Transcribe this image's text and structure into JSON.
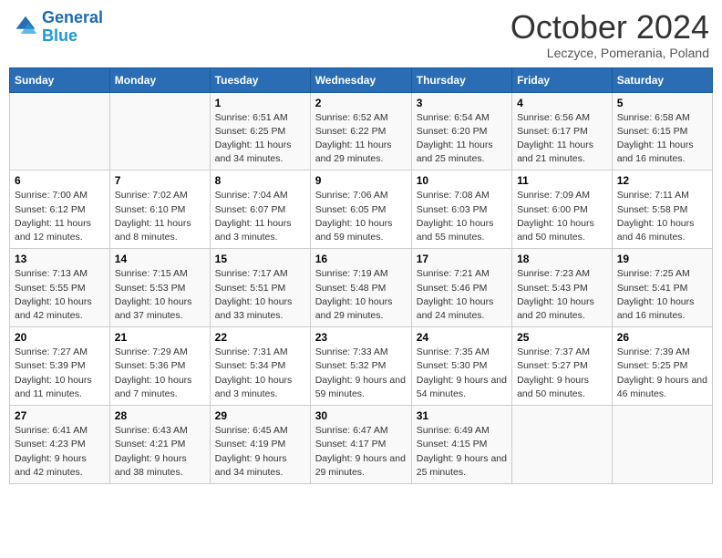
{
  "header": {
    "logo_line1": "General",
    "logo_line2": "Blue",
    "month": "October 2024",
    "location": "Leczyce, Pomerania, Poland"
  },
  "days_of_week": [
    "Sunday",
    "Monday",
    "Tuesday",
    "Wednesday",
    "Thursday",
    "Friday",
    "Saturday"
  ],
  "weeks": [
    [
      {
        "day": "",
        "sunrise": "",
        "sunset": "",
        "daylight": ""
      },
      {
        "day": "",
        "sunrise": "",
        "sunset": "",
        "daylight": ""
      },
      {
        "day": "1",
        "sunrise": "Sunrise: 6:51 AM",
        "sunset": "Sunset: 6:25 PM",
        "daylight": "Daylight: 11 hours and 34 minutes."
      },
      {
        "day": "2",
        "sunrise": "Sunrise: 6:52 AM",
        "sunset": "Sunset: 6:22 PM",
        "daylight": "Daylight: 11 hours and 29 minutes."
      },
      {
        "day": "3",
        "sunrise": "Sunrise: 6:54 AM",
        "sunset": "Sunset: 6:20 PM",
        "daylight": "Daylight: 11 hours and 25 minutes."
      },
      {
        "day": "4",
        "sunrise": "Sunrise: 6:56 AM",
        "sunset": "Sunset: 6:17 PM",
        "daylight": "Daylight: 11 hours and 21 minutes."
      },
      {
        "day": "5",
        "sunrise": "Sunrise: 6:58 AM",
        "sunset": "Sunset: 6:15 PM",
        "daylight": "Daylight: 11 hours and 16 minutes."
      }
    ],
    [
      {
        "day": "6",
        "sunrise": "Sunrise: 7:00 AM",
        "sunset": "Sunset: 6:12 PM",
        "daylight": "Daylight: 11 hours and 12 minutes."
      },
      {
        "day": "7",
        "sunrise": "Sunrise: 7:02 AM",
        "sunset": "Sunset: 6:10 PM",
        "daylight": "Daylight: 11 hours and 8 minutes."
      },
      {
        "day": "8",
        "sunrise": "Sunrise: 7:04 AM",
        "sunset": "Sunset: 6:07 PM",
        "daylight": "Daylight: 11 hours and 3 minutes."
      },
      {
        "day": "9",
        "sunrise": "Sunrise: 7:06 AM",
        "sunset": "Sunset: 6:05 PM",
        "daylight": "Daylight: 10 hours and 59 minutes."
      },
      {
        "day": "10",
        "sunrise": "Sunrise: 7:08 AM",
        "sunset": "Sunset: 6:03 PM",
        "daylight": "Daylight: 10 hours and 55 minutes."
      },
      {
        "day": "11",
        "sunrise": "Sunrise: 7:09 AM",
        "sunset": "Sunset: 6:00 PM",
        "daylight": "Daylight: 10 hours and 50 minutes."
      },
      {
        "day": "12",
        "sunrise": "Sunrise: 7:11 AM",
        "sunset": "Sunset: 5:58 PM",
        "daylight": "Daylight: 10 hours and 46 minutes."
      }
    ],
    [
      {
        "day": "13",
        "sunrise": "Sunrise: 7:13 AM",
        "sunset": "Sunset: 5:55 PM",
        "daylight": "Daylight: 10 hours and 42 minutes."
      },
      {
        "day": "14",
        "sunrise": "Sunrise: 7:15 AM",
        "sunset": "Sunset: 5:53 PM",
        "daylight": "Daylight: 10 hours and 37 minutes."
      },
      {
        "day": "15",
        "sunrise": "Sunrise: 7:17 AM",
        "sunset": "Sunset: 5:51 PM",
        "daylight": "Daylight: 10 hours and 33 minutes."
      },
      {
        "day": "16",
        "sunrise": "Sunrise: 7:19 AM",
        "sunset": "Sunset: 5:48 PM",
        "daylight": "Daylight: 10 hours and 29 minutes."
      },
      {
        "day": "17",
        "sunrise": "Sunrise: 7:21 AM",
        "sunset": "Sunset: 5:46 PM",
        "daylight": "Daylight: 10 hours and 24 minutes."
      },
      {
        "day": "18",
        "sunrise": "Sunrise: 7:23 AM",
        "sunset": "Sunset: 5:43 PM",
        "daylight": "Daylight: 10 hours and 20 minutes."
      },
      {
        "day": "19",
        "sunrise": "Sunrise: 7:25 AM",
        "sunset": "Sunset: 5:41 PM",
        "daylight": "Daylight: 10 hours and 16 minutes."
      }
    ],
    [
      {
        "day": "20",
        "sunrise": "Sunrise: 7:27 AM",
        "sunset": "Sunset: 5:39 PM",
        "daylight": "Daylight: 10 hours and 11 minutes."
      },
      {
        "day": "21",
        "sunrise": "Sunrise: 7:29 AM",
        "sunset": "Sunset: 5:36 PM",
        "daylight": "Daylight: 10 hours and 7 minutes."
      },
      {
        "day": "22",
        "sunrise": "Sunrise: 7:31 AM",
        "sunset": "Sunset: 5:34 PM",
        "daylight": "Daylight: 10 hours and 3 minutes."
      },
      {
        "day": "23",
        "sunrise": "Sunrise: 7:33 AM",
        "sunset": "Sunset: 5:32 PM",
        "daylight": "Daylight: 9 hours and 59 minutes."
      },
      {
        "day": "24",
        "sunrise": "Sunrise: 7:35 AM",
        "sunset": "Sunset: 5:30 PM",
        "daylight": "Daylight: 9 hours and 54 minutes."
      },
      {
        "day": "25",
        "sunrise": "Sunrise: 7:37 AM",
        "sunset": "Sunset: 5:27 PM",
        "daylight": "Daylight: 9 hours and 50 minutes."
      },
      {
        "day": "26",
        "sunrise": "Sunrise: 7:39 AM",
        "sunset": "Sunset: 5:25 PM",
        "daylight": "Daylight: 9 hours and 46 minutes."
      }
    ],
    [
      {
        "day": "27",
        "sunrise": "Sunrise: 6:41 AM",
        "sunset": "Sunset: 4:23 PM",
        "daylight": "Daylight: 9 hours and 42 minutes."
      },
      {
        "day": "28",
        "sunrise": "Sunrise: 6:43 AM",
        "sunset": "Sunset: 4:21 PM",
        "daylight": "Daylight: 9 hours and 38 minutes."
      },
      {
        "day": "29",
        "sunrise": "Sunrise: 6:45 AM",
        "sunset": "Sunset: 4:19 PM",
        "daylight": "Daylight: 9 hours and 34 minutes."
      },
      {
        "day": "30",
        "sunrise": "Sunrise: 6:47 AM",
        "sunset": "Sunset: 4:17 PM",
        "daylight": "Daylight: 9 hours and 29 minutes."
      },
      {
        "day": "31",
        "sunrise": "Sunrise: 6:49 AM",
        "sunset": "Sunset: 4:15 PM",
        "daylight": "Daylight: 9 hours and 25 minutes."
      },
      {
        "day": "",
        "sunrise": "",
        "sunset": "",
        "daylight": ""
      },
      {
        "day": "",
        "sunrise": "",
        "sunset": "",
        "daylight": ""
      }
    ]
  ]
}
